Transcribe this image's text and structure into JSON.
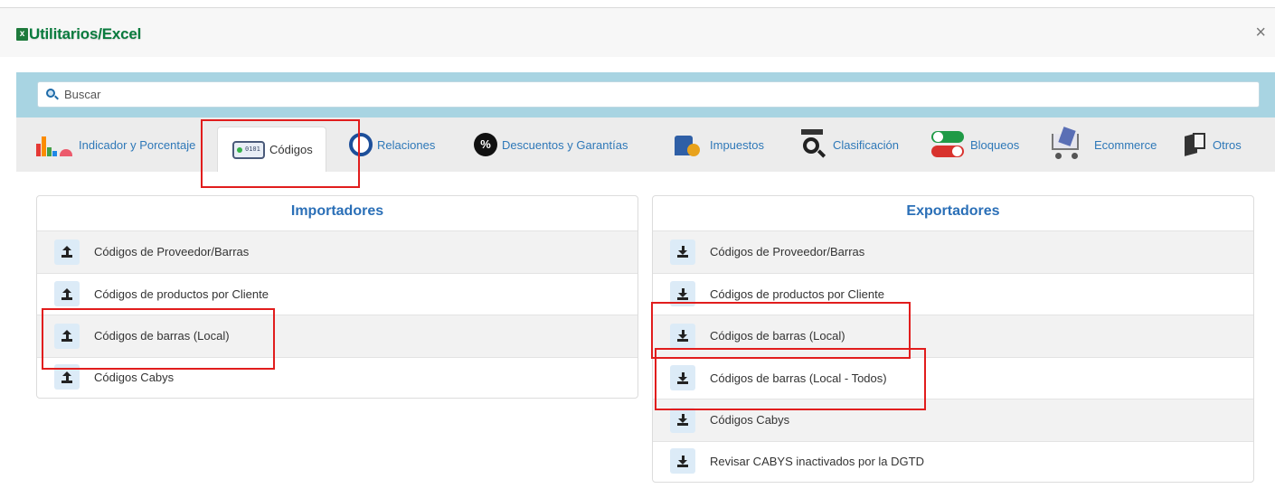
{
  "window": {
    "title": "Utilitarios/Excel",
    "close_glyph": "×"
  },
  "search": {
    "placeholder": "Buscar"
  },
  "tabs": [
    {
      "label": "Indicador y Porcentaje",
      "icon": "chart-icon"
    },
    {
      "label": "Códigos",
      "icon": "code-card-icon",
      "active": true
    },
    {
      "label": "Relaciones",
      "icon": "ring-icon"
    },
    {
      "label": "Descuentos y Garantías",
      "icon": "percent-icon"
    },
    {
      "label": "Impuestos",
      "icon": "building-coin-icon"
    },
    {
      "label": "Clasificación",
      "icon": "magnifier-icon"
    },
    {
      "label": "Bloqueos",
      "icon": "toggle-icon"
    },
    {
      "label": "Ecommerce",
      "icon": "cart-icon"
    },
    {
      "label": "Otros",
      "icon": "files-icon"
    }
  ],
  "importadores": {
    "title": "Importadores",
    "items": [
      {
        "label": "Códigos de Proveedor/Barras"
      },
      {
        "label": "Códigos de productos por Cliente"
      },
      {
        "label": "Códigos de barras (Local)"
      },
      {
        "label": "Códigos Cabys"
      }
    ]
  },
  "exportadores": {
    "title": "Exportadores",
    "items": [
      {
        "label": "Códigos de Proveedor/Barras"
      },
      {
        "label": "Códigos de productos por Cliente"
      },
      {
        "label": "Códigos de barras (Local)"
      },
      {
        "label": "Códigos de barras (Local - Todos)"
      },
      {
        "label": "Códigos Cabys"
      },
      {
        "label": "Revisar CABYS inactivados por la DGTD"
      }
    ]
  },
  "colors": {
    "accent": "#2a6fb7",
    "search_band": "#a8d4e2",
    "highlight": "#e11d1d",
    "title_green": "#0a7b3e"
  }
}
